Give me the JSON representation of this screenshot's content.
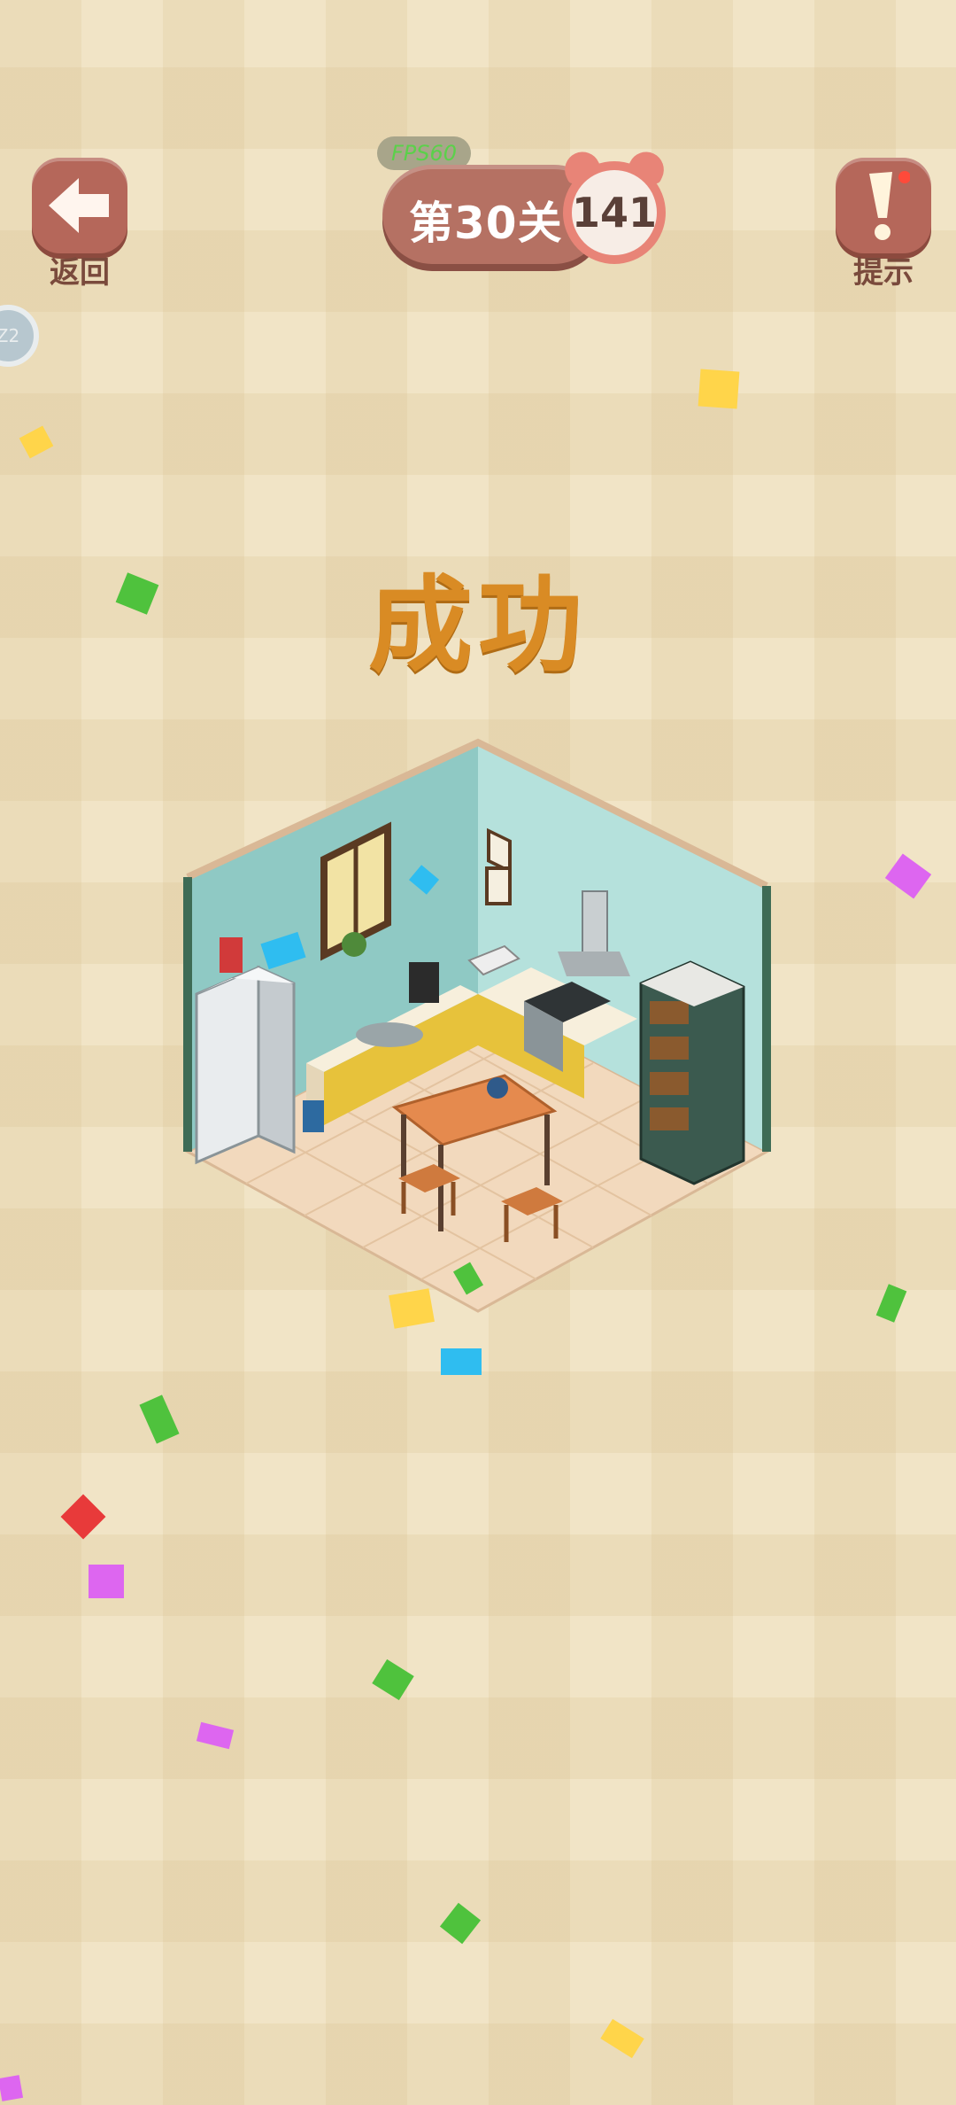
{
  "header": {
    "back_label": "返回",
    "hint_label": "提示",
    "fps_label": "FPS60",
    "level_label": "第30关",
    "timer_value": "141"
  },
  "side": {
    "badge_text": "Z2"
  },
  "result": {
    "title": "成功"
  },
  "scene": {
    "name": "kitchen-room",
    "description_icon": "isometric-kitchen-illustration"
  },
  "colors": {
    "background": "#f1e4c6",
    "button": "#b5675a",
    "title": "#d98b24",
    "confetti": [
      "#ffd54a",
      "#4fc23d",
      "#dd66f0",
      "#2fbdf0",
      "#e83a3a"
    ]
  }
}
